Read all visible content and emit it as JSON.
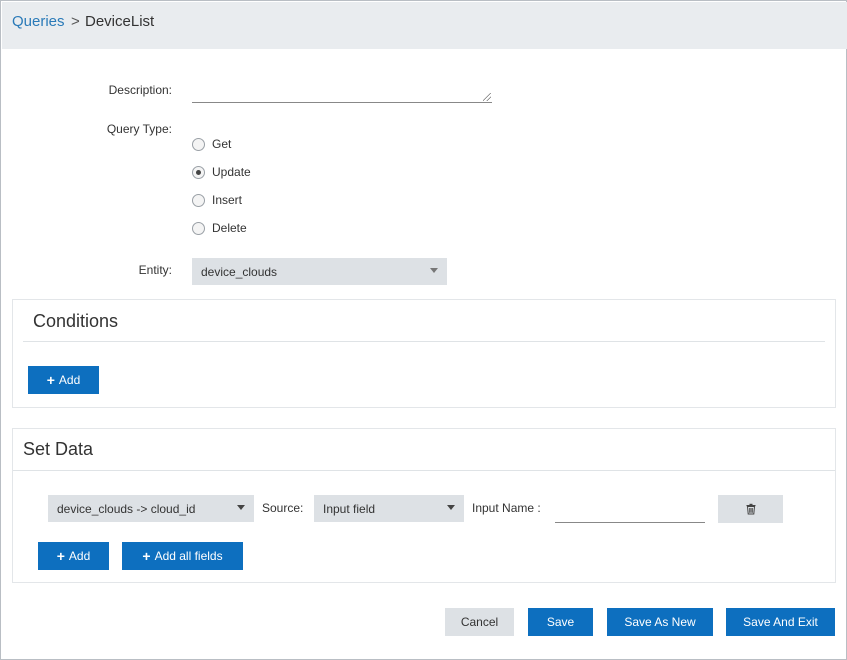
{
  "breadcrumb": {
    "parent": "Queries",
    "separator": ">",
    "current": "DeviceList"
  },
  "form": {
    "description_label": "Description:",
    "description_value": "",
    "query_type_label": "Query Type:",
    "query_types": [
      {
        "label": "Get",
        "selected": false
      },
      {
        "label": "Update",
        "selected": true
      },
      {
        "label": "Insert",
        "selected": false
      },
      {
        "label": "Delete",
        "selected": false
      }
    ],
    "entity_label": "Entity:",
    "entity_value": "device_clouds"
  },
  "conditions": {
    "title": "Conditions",
    "add_label": "Add"
  },
  "set_data": {
    "title": "Set Data",
    "row": {
      "field_value": "device_clouds -> cloud_id",
      "source_label": "Source:",
      "source_value": "Input field",
      "input_name_label": "Input Name :",
      "input_name_value": ""
    },
    "add_label": "Add",
    "add_all_label": "Add all fields"
  },
  "footer": {
    "cancel_label": "Cancel",
    "save_label": "Save",
    "save_as_new_label": "Save As New",
    "save_and_exit_label": "Save And Exit"
  },
  "colors": {
    "primary": "#0d6fbf",
    "link": "#2a7ab8",
    "header_bg": "#e9ecef",
    "control_bg": "#dde1e5"
  }
}
